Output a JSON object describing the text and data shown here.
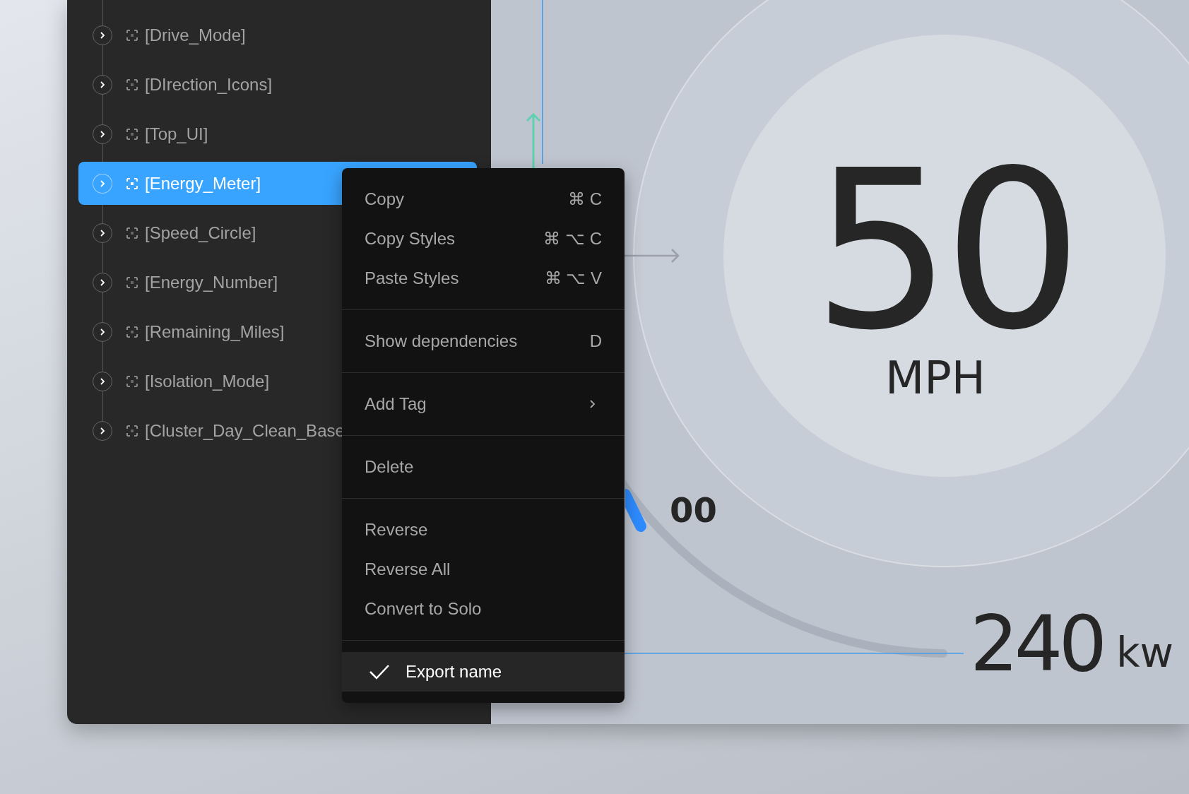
{
  "layers": [
    {
      "label": "[Drive_Mode]",
      "selected": false
    },
    {
      "label": "[DIrection_Icons]",
      "selected": false
    },
    {
      "label": "[Top_UI]",
      "selected": false
    },
    {
      "label": "[Energy_Meter]",
      "selected": true
    },
    {
      "label": "[Speed_Circle]",
      "selected": false
    },
    {
      "label": "[Energy_Number]",
      "selected": false
    },
    {
      "label": "[Remaining_Miles]",
      "selected": false
    },
    {
      "label": "[Isolation_Mode]",
      "selected": false
    },
    {
      "label": "[Cluster_Day_Clean_Base",
      "selected": false
    }
  ],
  "context_menu": {
    "groups": [
      [
        {
          "kind": "command",
          "label": "Copy",
          "shortcut": "⌘ C",
          "selected": false
        },
        {
          "kind": "command",
          "label": "Copy Styles",
          "shortcut": "⌘ ⌥ C",
          "selected": false
        },
        {
          "kind": "command",
          "label": "Paste Styles",
          "shortcut": "⌘ ⌥ V",
          "selected": false
        }
      ],
      [
        {
          "kind": "command",
          "label": "Show dependencies",
          "shortcut": "D",
          "selected": false
        }
      ],
      [
        {
          "kind": "submenu",
          "label": "Add Tag",
          "selected": false
        }
      ],
      [
        {
          "kind": "command",
          "label": "Delete",
          "selected": false
        }
      ],
      [
        {
          "kind": "command",
          "label": "Reverse",
          "selected": false
        },
        {
          "kind": "command",
          "label": "Reverse All",
          "selected": false
        },
        {
          "kind": "command",
          "label": "Convert to Solo",
          "selected": false
        }
      ],
      [
        {
          "kind": "check",
          "label": "Export name",
          "checked": true,
          "selected": true
        }
      ]
    ]
  },
  "canvas": {
    "speed": "50",
    "speed_unit": "MPH",
    "range_number": "00",
    "power": "240",
    "power_unit": "kw"
  }
}
